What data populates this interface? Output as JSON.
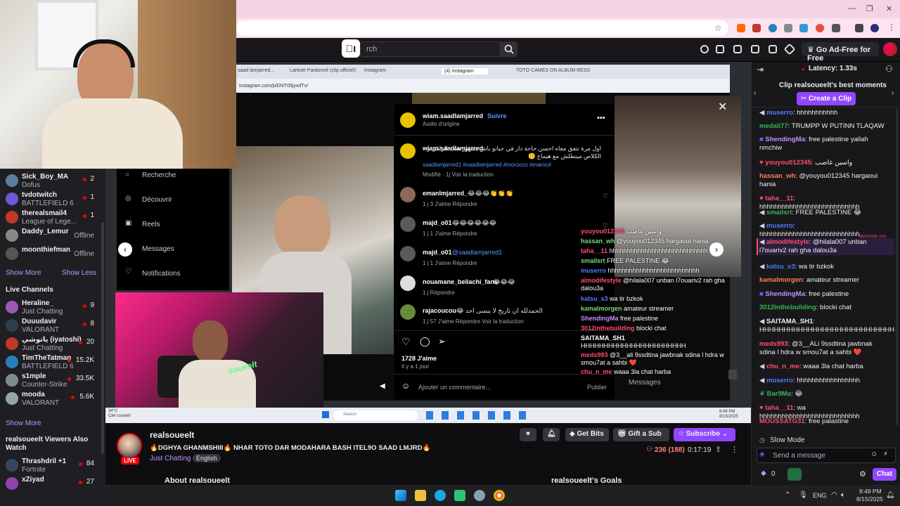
{
  "browser": {
    "window_controls": [
      "—",
      "❐",
      "✕"
    ],
    "colors": {
      "tabbar": "#f6d3e4",
      "address": "#fbe3ef"
    }
  },
  "twitch": {
    "logo": "ו⃞",
    "search_placeholder": "rch",
    "ad_free_label": "Go Ad-Free for Free",
    "accent": "#9147ff"
  },
  "sidebar": {
    "followed": [
      {
        "name": "Sick_Boy_MA",
        "game": "Dofus",
        "count": "2",
        "color": "#5a7d9a"
      },
      {
        "name": "tvdotwitch",
        "game": "BATTLEFIELD 6",
        "count": "1",
        "color": "#6b5bd6"
      },
      {
        "name": "therealsmail4",
        "game": "League of Lege...",
        "count": "1",
        "color": "#c0392b"
      },
      {
        "name": "Daddy_Lemur",
        "game": "",
        "count": "Offline",
        "color": "#888"
      },
      {
        "name": "moonthiefman",
        "game": "",
        "count": "Offline",
        "color": "#555"
      }
    ],
    "show_more": "Show More",
    "show_less": "Show Less",
    "live_header": "Live Channels",
    "live": [
      {
        "name": "Heraline_",
        "game": "Just Chatting",
        "count": "9",
        "color": "#9b59b6"
      },
      {
        "name": "Duuudavir",
        "game": "VALORANT",
        "count": "8",
        "color": "#2c3e50"
      },
      {
        "name": "ياتوشي (iyatoshi)",
        "game": "Just Chatting",
        "count": "20",
        "color": "#c0392b"
      },
      {
        "name": "TimTheTatman",
        "game": "BATTLEFIELD 6",
        "count": "15.2K",
        "color": "#2980b9"
      },
      {
        "name": "s1mple",
        "game": "Counter-Strike",
        "count": "33.5K",
        "color": "#7f8c8d"
      },
      {
        "name": "mooda",
        "game": "VALORANT",
        "count": "5.6K",
        "color": "#95a5a6"
      }
    ],
    "show_more_2": "Show More",
    "also_watch_header": "realsoueelt Viewers Also Watch",
    "also_watch": [
      {
        "name": "Thrashdril +1",
        "game": "Fortnite",
        "count": "84",
        "color": "#34495e"
      },
      {
        "name": "xZiyad",
        "game": "",
        "count": "27",
        "color": "#8e44ad"
      }
    ]
  },
  "video": {
    "inner_tabs": [
      "saad lamjarred...",
      "Lartiste Pardonné (clip officiel)",
      "Instagram",
      "(4) Instagram",
      "TOTO CAMES ON ALBUM RESS"
    ],
    "inner_url": "instagram.com/p/DNT05jyxdTv/",
    "ig_nav": [
      "Recherche",
      "Découvrir",
      "Reels",
      "Messages",
      "Notifications"
    ],
    "post_author": "wiam.saadlamjarred",
    "follow": "Suivre",
    "audio": "Audio d'origine",
    "caption": "اول مرة تتفق معاه احسن حاجة دار في حياتو باش جمهور سعد الراقي و الكلاص ميتطلش مع هيماع 🙂",
    "caption_tags": "saadlamjarred1 #saadlamjarred #morocco #maroc#",
    "caption_meta": "Modifié · 1j   Voir la traduction",
    "comments": [
      {
        "user": "emanlmjarred_",
        "text": "😂😂😂👏👏👏",
        "meta": "1 j   3 J'aime   Répondre"
      },
      {
        "user": "majd_o01",
        "text": "😂😂😂😂😂😂",
        "meta": "1 j   1 J'aime   Répondre"
      },
      {
        "user": "majd_o01",
        "text": "@saadlamjarred1",
        "meta": "1 j   1 J'aime   Répondre"
      },
      {
        "user": "nouamane_beliachi_fans",
        "text": "😂😂😂",
        "meta": "1 j   Répondre"
      },
      {
        "user": "rajacoucou",
        "text": "😂 الحمدلله ان تاريخ لا ينسى احد",
        "meta": "1 j   57 J'aime   Répondre   Voir la traduction"
      }
    ],
    "likes": "1728 J'aime",
    "likes_time": "Il y a 1 jour",
    "add_comment": "Ajouter un commentaire...",
    "publish": "Publier",
    "overlay_chat": [
      {
        "user": "youyou012345",
        "text": "واسين غاضب",
        "ucolor": "#ff4d6d"
      },
      {
        "user": "hassan_wh",
        "text": "@youyou012345 hargaoui hania",
        "ucolor": "#7dd87d"
      },
      {
        "user": "taha__11",
        "text": "hhhhhhhhhhhhhhhhhhhhhhhhhhhh",
        "ucolor": "#ff4d6d"
      },
      {
        "user": "smailsrt",
        "text": "FREE PALESTINE 😂",
        "ucolor": "#7dd87d"
      },
      {
        "user": "muserro",
        "text": "hhhhhhhhhhhhhhhhhhhhhhhhhh",
        "ucolor": "#4f7bff"
      },
      {
        "user": "almodifestyle",
        "text": "@hilala007 unban l7ouariv2 rah gha dalou3a",
        "ucolor": "#ff4d6d"
      },
      {
        "user": "katsu_s3",
        "text": "wa tir bzkok",
        "ucolor": "#4f7bff"
      },
      {
        "user": "kamalmorgen",
        "text": "amateur streamer",
        "ucolor": "#7dd87d"
      },
      {
        "user": "ShendingMa",
        "text": "free palestine",
        "ucolor": "#bf94ff"
      },
      {
        "user": "3012inthebuilding",
        "text": "blocki chat",
        "ucolor": "#ff4d6d"
      },
      {
        "user": "SAITAMA_SH1",
        "text": "HHHHHHHHHHHHHHHHHHHHHHH",
        "ucolor": "#fff"
      },
      {
        "user": "meds993",
        "text": "@3__ali 9ssdtina jawbnak sdina l hdra w smou7at a sahbi ❤️",
        "ucolor": "#ff4d6d"
      },
      {
        "user": "chu_n_me",
        "text": "waaa 3la chat harba",
        "ucolor": "#ff4d6d"
      }
    ],
    "overlay_messages": "Messages",
    "inner_taskbar_search": "Search",
    "inner_clock": "8:49 PM\n8/15/2025",
    "weather": "34°C\nCiel couvert"
  },
  "stream_info": {
    "channel": "realsoueelt",
    "live_badge": "LIVE",
    "title": "🔥DGHYA GHANMSHIII🔥 NHAR TOTO DAR MODAHARA BASH ITEL9O SAAD LMJRD🔥",
    "category": "Just Chatting",
    "tag": "English",
    "viewers": "236 (188)",
    "uptime": "0:17:19",
    "get_bits": "Get Bits",
    "gift_sub": "Gift a Sub",
    "subscribe": "Subscribe",
    "about": "About realsoueelt",
    "goals": "realsoueelt's Goals"
  },
  "chat": {
    "latency": "Latency: 1.33s",
    "clip_title": "Clip realsoueelt's best moments",
    "create_clip": "Create a Clip",
    "messages": [
      {
        "user": "muserro",
        "text": "hhhhhhhhhhh",
        "color": "#4f7bff",
        "badge": "mod"
      },
      {
        "user": "medali77",
        "text": "TRUMPP W PUTINN TLAQAW",
        "color": "#2fb84f",
        "badge": ""
      },
      {
        "user": "ShendingMa",
        "text": "free palestine yallah nmchiw",
        "color": "#bf94ff",
        "badge": "sub"
      },
      {
        "user": "youyou012345",
        "text": "واسين غاضب",
        "color": "#ff4d6d",
        "badge": "heart"
      },
      {
        "user": "hassan_wh",
        "text": "@youyou012345 hargaoui hania",
        "color": "#ff7f50",
        "badge": ""
      },
      {
        "user": "taha__11",
        "text": "hhhhhhhhhhhhhhhhhhhhhhhhhhh",
        "color": "#ff4d6d",
        "badge": "heart"
      },
      {
        "user": "smailsrt",
        "text": "FREE PALESTINE 😂",
        "color": "#2fb84f",
        "badge": "mod"
      },
      {
        "user": "muserro",
        "text": "hhhhhhhhhhhhhhhhhhhhhhhhhhh",
        "color": "#4f7bff",
        "badge": "mod"
      },
      {
        "user": "almodifestyle",
        "text": "@hilala007 unban l7ouariv2 rah gha dalou3a",
        "color": "#ff4d6d",
        "badge": "mod"
      },
      {
        "user": "katsu_s3",
        "text": "wa tir bzkok",
        "color": "#4f7bff",
        "badge": "mod"
      },
      {
        "user": "kamalmorgen",
        "text": "amateur streamer",
        "color": "#ff7f50",
        "badge": ""
      },
      {
        "user": "ShendingMa",
        "text": "free palestine",
        "color": "#bf94ff",
        "badge": "sub"
      },
      {
        "user": "3012inthebuilding",
        "text": "blocki chat",
        "color": "#2fb84f",
        "badge": ""
      },
      {
        "user": "SAITAMA_SH1",
        "text": "HHHHHHHHHHHHHHHHHHHHHHHHHHHH",
        "color": "#efeff1",
        "badge": "mod"
      },
      {
        "user": "meds993",
        "text": "@3__ALi 9ssdtina jawbnak sdina l hdra w smou7at a sahbi ❤️",
        "color": "#ff4d6d",
        "badge": ""
      },
      {
        "user": "chu_n_me",
        "text": "waaa 3la chat harba",
        "color": "#ff4d6d",
        "badge": "mod"
      },
      {
        "user": "muserro",
        "text": "hhhhhhhhhhhhhhhhh",
        "color": "#4f7bff",
        "badge": "mod"
      },
      {
        "user": "Bar9Ma",
        "text": "😂",
        "color": "#2fb84f",
        "badge": "leaf"
      },
      {
        "user": "taha__11",
        "text": "wa hhhhhhhhhhhhhhhhhhhhhhhhhhh",
        "color": "#ff4d6d",
        "badge": "heart"
      },
      {
        "user": "MOUSSATG31",
        "text": "free palastine",
        "color": "#ff4d6d",
        "badge": ""
      }
    ],
    "mentions_label": "MENTIONS YOU",
    "slow_mode": "Slow Mode",
    "send_placeholder": "Send a message",
    "points": "0",
    "chat_button": "Chat"
  },
  "taskbar": {
    "lang": "ENG",
    "time": "8:49 PM",
    "date": "8/15/2025"
  }
}
